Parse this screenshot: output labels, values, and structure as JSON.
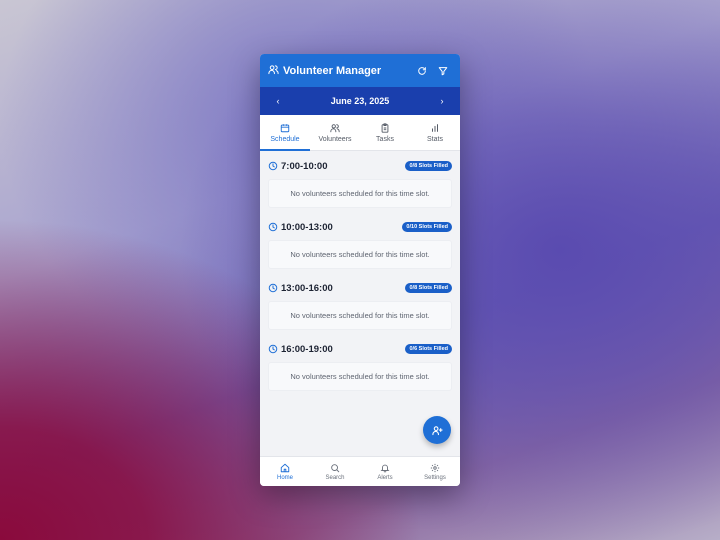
{
  "header": {
    "title": "Volunteer Manager",
    "refresh_icon": "refresh-icon",
    "filter_icon": "filter-icon"
  },
  "date_bar": {
    "date": "June 23, 2025",
    "prev": "‹",
    "next": "›"
  },
  "tabs": [
    {
      "label": "Schedule",
      "icon": "calendar-icon",
      "active": true
    },
    {
      "label": "Volunteers",
      "icon": "users-icon",
      "active": false
    },
    {
      "label": "Tasks",
      "icon": "clipboard-icon",
      "active": false
    },
    {
      "label": "Stats",
      "icon": "bar-chart-icon",
      "active": false
    }
  ],
  "slots": [
    {
      "time": "7:00-10:00",
      "badge": "0/8 Slots Filled",
      "empty_text": "No volunteers scheduled for this time slot."
    },
    {
      "time": "10:00-13:00",
      "badge": "0/10 Slots Filled",
      "empty_text": "No volunteers scheduled for this time slot."
    },
    {
      "time": "13:00-16:00",
      "badge": "0/8 Slots Filled",
      "empty_text": "No volunteers scheduled for this time slot."
    },
    {
      "time": "16:00-19:00",
      "badge": "0/6 Slots Filled",
      "empty_text": "No volunteers scheduled for this time slot."
    }
  ],
  "fab": {
    "icon": "add-user-icon"
  },
  "bottom_nav": [
    {
      "label": "Home",
      "icon": "home-icon",
      "active": true
    },
    {
      "label": "Search",
      "icon": "search-icon",
      "active": false
    },
    {
      "label": "Alerts",
      "icon": "bell-icon",
      "active": false
    },
    {
      "label": "Settings",
      "icon": "gear-icon",
      "active": false
    }
  ],
  "colors": {
    "primary": "#1f6fd6",
    "date_bar": "#1a3fad",
    "badge": "#1a5fc8"
  }
}
